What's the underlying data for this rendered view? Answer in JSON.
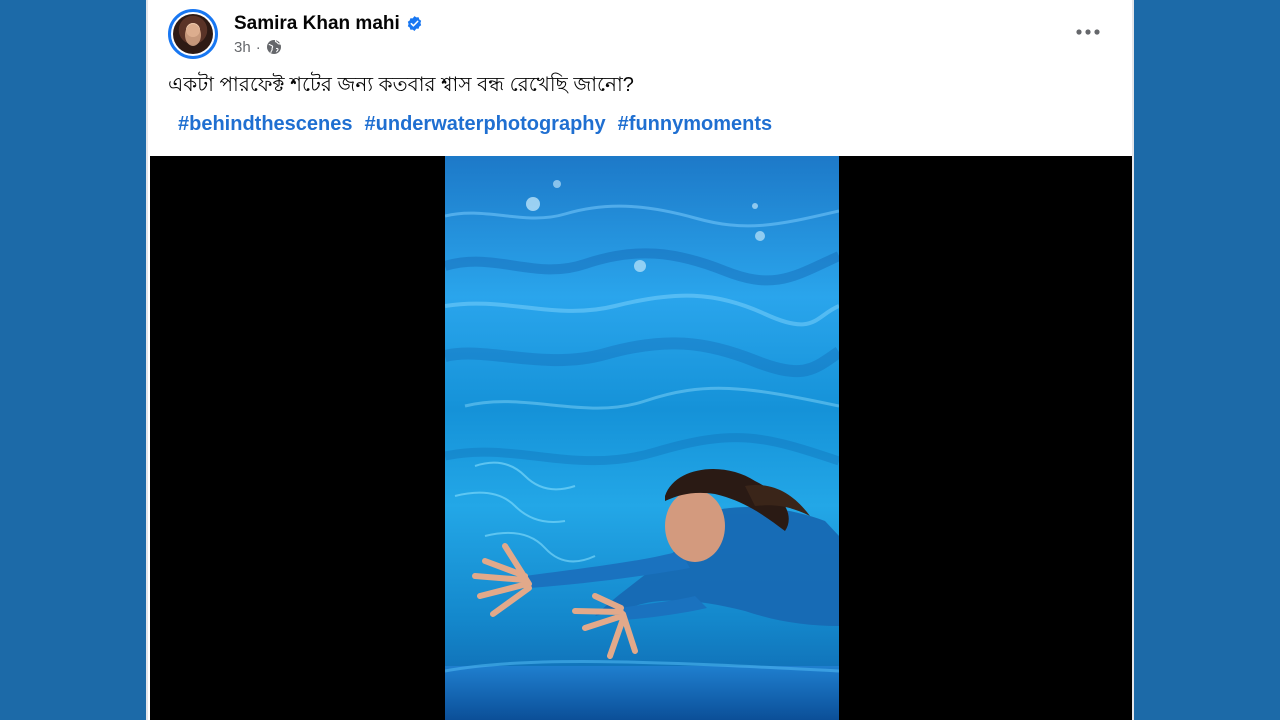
{
  "post": {
    "author_name": "Samira Khan mahi",
    "time": "3h",
    "separator": "·",
    "caption": "একটা পারফেক্ট শটের জন্য কতবার শ্বাস বন্ধ রেখেছি জানো?",
    "hashtags": [
      "#behindthescenes",
      "#underwaterphotography",
      "#funnymoments"
    ]
  },
  "icons": {
    "verified": "verified-badge-icon",
    "audience": "globe-icon",
    "menu": "more-options-icon"
  },
  "colors": {
    "page_background": "#1c6aa8",
    "hashtag": "#1f6fd1",
    "verified": "#1877f2"
  }
}
